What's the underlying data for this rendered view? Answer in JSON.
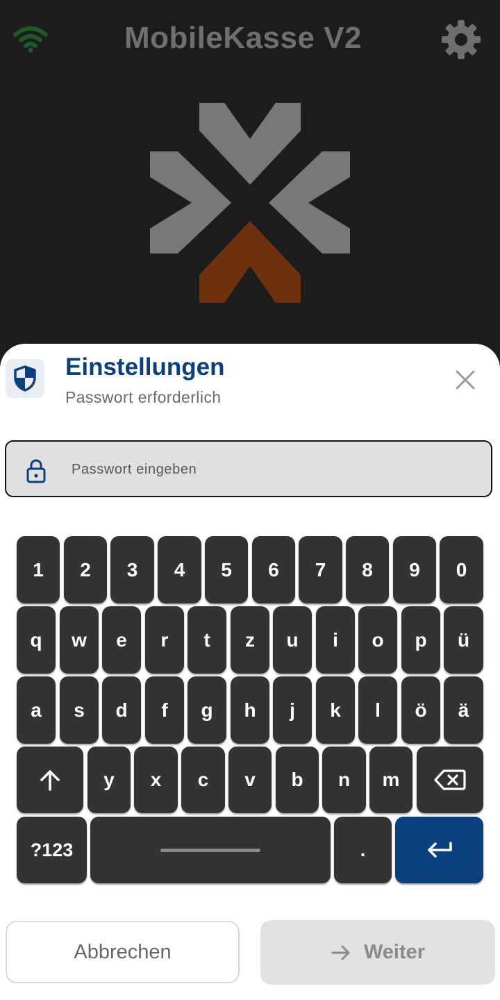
{
  "header": {
    "title": "MobileKasse V2",
    "wifi_icon": "wifi-icon",
    "settings_icon": "gear-icon"
  },
  "colors": {
    "accent": "#0b3f7e",
    "wifi": "#1d5a2a",
    "logo_gray": "#787878",
    "logo_accent": "#6f3010"
  },
  "dialog": {
    "title": "Einstellungen",
    "subtitle": "Passwort erforderlich",
    "password": {
      "value": "",
      "placeholder": "Passwort eingeben"
    }
  },
  "keyboard": {
    "row1": [
      "1",
      "2",
      "3",
      "4",
      "5",
      "6",
      "7",
      "8",
      "9",
      "0"
    ],
    "row2": [
      "q",
      "w",
      "e",
      "r",
      "t",
      "z",
      "u",
      "i",
      "o",
      "p",
      "ü"
    ],
    "row3": [
      "a",
      "s",
      "d",
      "f",
      "g",
      "h",
      "j",
      "k",
      "l",
      "ö",
      "ä"
    ],
    "row4": [
      "y",
      "x",
      "c",
      "v",
      "b",
      "n",
      "m"
    ],
    "symbols_label": "?123",
    "period_label": "."
  },
  "actions": {
    "cancel_label": "Abbrechen",
    "next_label": "Weiter"
  }
}
